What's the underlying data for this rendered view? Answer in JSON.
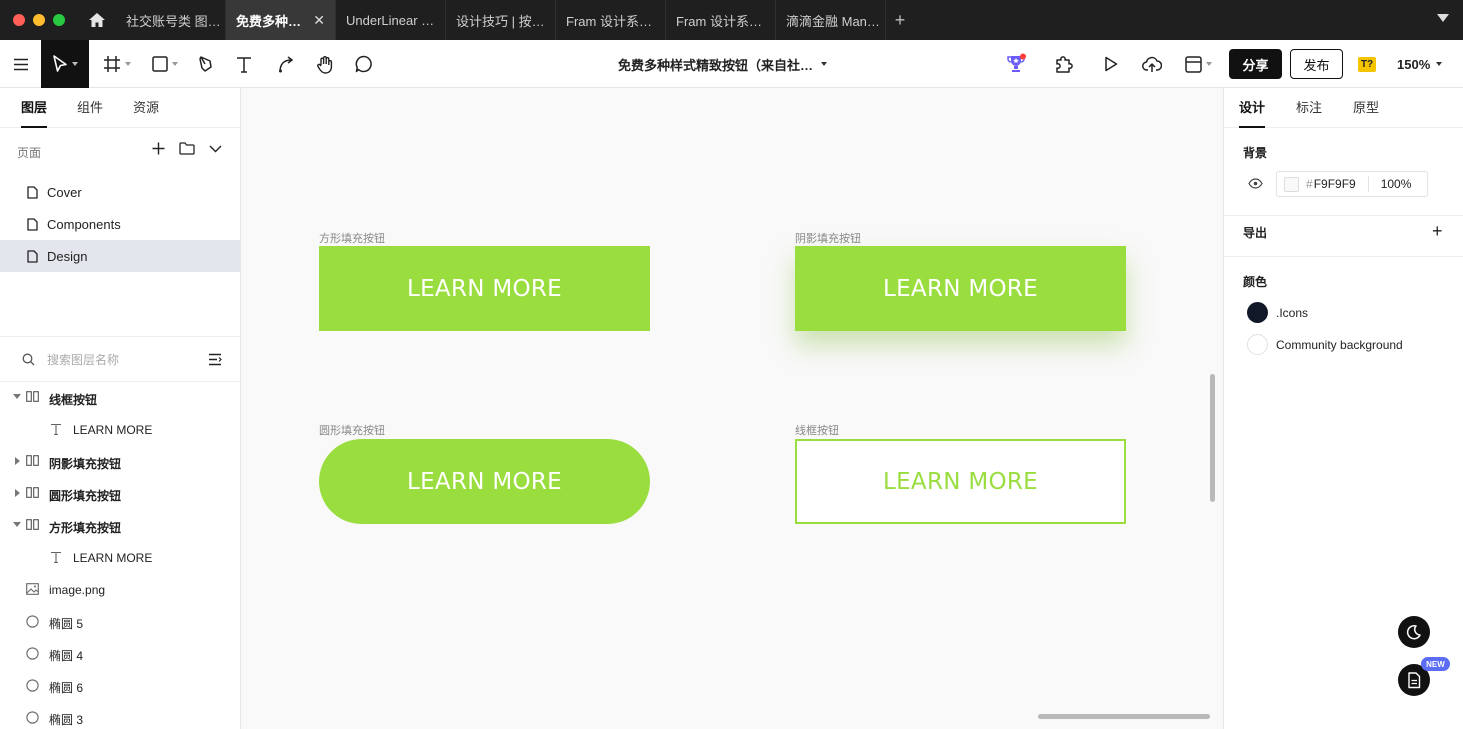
{
  "window": {
    "traffic_colors": {
      "close": "#ff5f57",
      "minimize": "#febc2e",
      "maximize": "#28c840"
    }
  },
  "tabs": [
    {
      "label": "社交账号类 图…",
      "active": false
    },
    {
      "label": "免费多种…",
      "active": true
    },
    {
      "label": "UnderLinear …",
      "active": false
    },
    {
      "label": "设计技巧 | 按…",
      "active": false
    },
    {
      "label": "Fram 设计系…",
      "active": false
    },
    {
      "label": "Fram 设计系…",
      "active": false
    },
    {
      "label": "滴滴金融 Man…",
      "active": false
    }
  ],
  "tab_close_glyph": "✕",
  "tab_add_glyph": "+",
  "toolbar": {
    "doc_title": "免费多种样式精致按钮（来自社…",
    "share_label": "分享",
    "publish_label": "发布",
    "t_badge": "T?",
    "zoom": "150%"
  },
  "left_panel": {
    "tabs": [
      "图层",
      "组件",
      "资源"
    ],
    "active_tab": "图层",
    "pages_heading": "页面",
    "pages": [
      {
        "name": "Cover",
        "selected": false
      },
      {
        "name": "Components",
        "selected": false
      },
      {
        "name": "Design",
        "selected": true
      }
    ],
    "search_placeholder": "搜索图层名称",
    "layers": [
      {
        "name": "线框按钮",
        "type": "frame",
        "expanded": true,
        "bold": true,
        "indent": 0
      },
      {
        "name": "LEARN MORE",
        "type": "text",
        "bold": false,
        "indent": 1
      },
      {
        "name": "阴影填充按钮",
        "type": "frame",
        "expanded": false,
        "bold": true,
        "indent": 0
      },
      {
        "name": "圆形填充按钮",
        "type": "frame",
        "expanded": false,
        "bold": true,
        "indent": 0
      },
      {
        "name": "方形填充按钮",
        "type": "frame",
        "expanded": true,
        "bold": true,
        "indent": 0
      },
      {
        "name": "LEARN MORE",
        "type": "text",
        "bold": false,
        "indent": 1
      },
      {
        "name": "image.png",
        "type": "image",
        "bold": false,
        "indent": 0
      },
      {
        "name": "椭圆 5",
        "type": "ellipse",
        "bold": false,
        "indent": 0
      },
      {
        "name": "椭圆 4",
        "type": "ellipse",
        "bold": false,
        "indent": 0
      },
      {
        "name": "椭圆 6",
        "type": "ellipse",
        "bold": false,
        "indent": 0
      },
      {
        "name": "椭圆 3",
        "type": "ellipse",
        "bold": false,
        "indent": 0
      }
    ]
  },
  "canvas": {
    "background": "#F9F9F9",
    "accent": "#99dd3f",
    "frames": [
      {
        "label": "方形填充按钮",
        "button_text": "LEARN MORE",
        "style": "fill"
      },
      {
        "label": "阴影填充按钮",
        "button_text": "LEARN MORE",
        "style": "shadow"
      },
      {
        "label": "圆形填充按钮",
        "button_text": "LEARN MORE",
        "style": "round"
      },
      {
        "label": "线框按钮",
        "button_text": "LEARN MORE",
        "style": "outline"
      }
    ]
  },
  "right_panel": {
    "tabs": [
      "设计",
      "标注",
      "原型"
    ],
    "active_tab": "设计",
    "background_heading": "背景",
    "background_hash": "#",
    "background_hex": "F9F9F9",
    "background_opacity": "100%",
    "export_heading": "导出",
    "export_add": "+",
    "colors_heading": "颜色",
    "colors": [
      {
        "name": ".Icons",
        "hex": "#111827"
      },
      {
        "name": "Community background",
        "hex": "#ffffff"
      }
    ]
  },
  "new_badge": "NEW"
}
